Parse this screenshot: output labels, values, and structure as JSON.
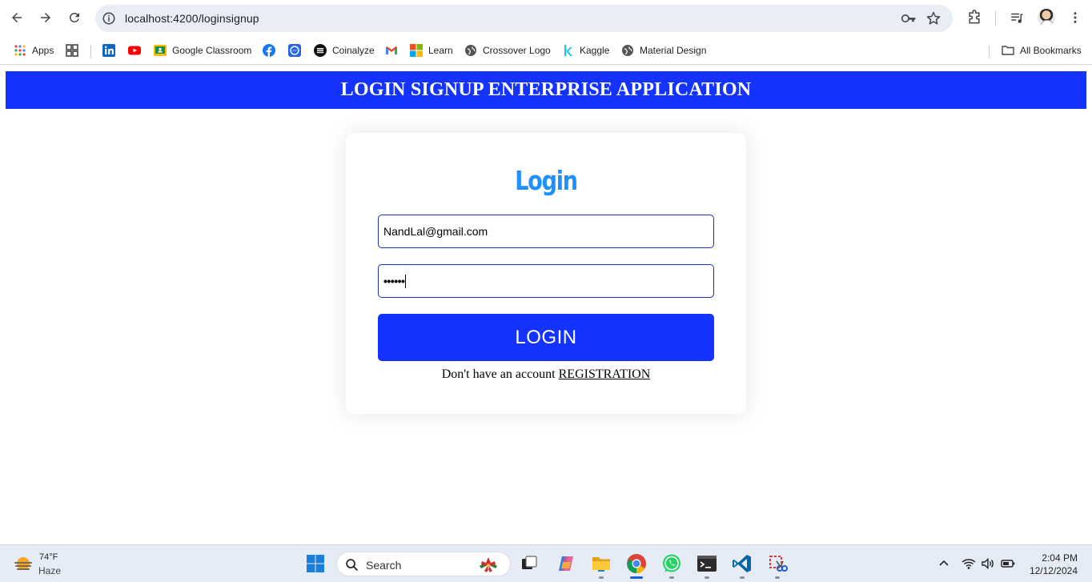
{
  "browser": {
    "url": "localhost:4200/loginsignup",
    "bookmarks": [
      {
        "label": "Apps",
        "icon": "apps-grid-icon"
      },
      {
        "label": "",
        "icon": "tab-groups-icon"
      },
      {
        "label": "",
        "icon": "linkedin-icon"
      },
      {
        "label": "",
        "icon": "youtube-icon"
      },
      {
        "label": "Google Classroom",
        "icon": "google-classroom-icon"
      },
      {
        "label": "",
        "icon": "facebook-icon"
      },
      {
        "label": "",
        "icon": "messenger-icon"
      },
      {
        "label": "Coinalyze",
        "icon": "coinalyze-icon"
      },
      {
        "label": "",
        "icon": "gmail-icon"
      },
      {
        "label": "Learn",
        "icon": "microsoft-icon"
      },
      {
        "label": "Crossover Logo",
        "icon": "globe-icon"
      },
      {
        "label": "Kaggle",
        "icon": "kaggle-icon"
      },
      {
        "label": "Material Design",
        "icon": "globe-icon"
      }
    ],
    "all_bookmarks_label": "All Bookmarks"
  },
  "page": {
    "header_title": "LOGIN SIGNUP ENTERPRISE APPLICATION",
    "card_title": "Login",
    "email_value": "NandLal@gmail.com",
    "password_value": "••••••",
    "login_button": "LOGIN",
    "signup_prompt": "Don't have an account",
    "signup_link": "REGISTRATION"
  },
  "taskbar": {
    "weather_temp": "74°F",
    "weather_condition": "Haze",
    "search_label": "Search",
    "time": "2:04 PM",
    "date": "12/12/2024"
  },
  "colors": {
    "header_bg": "#1433ff",
    "button_bg": "#1433ff",
    "title_color": "#1e90ff",
    "field_border": "#1433c4"
  }
}
